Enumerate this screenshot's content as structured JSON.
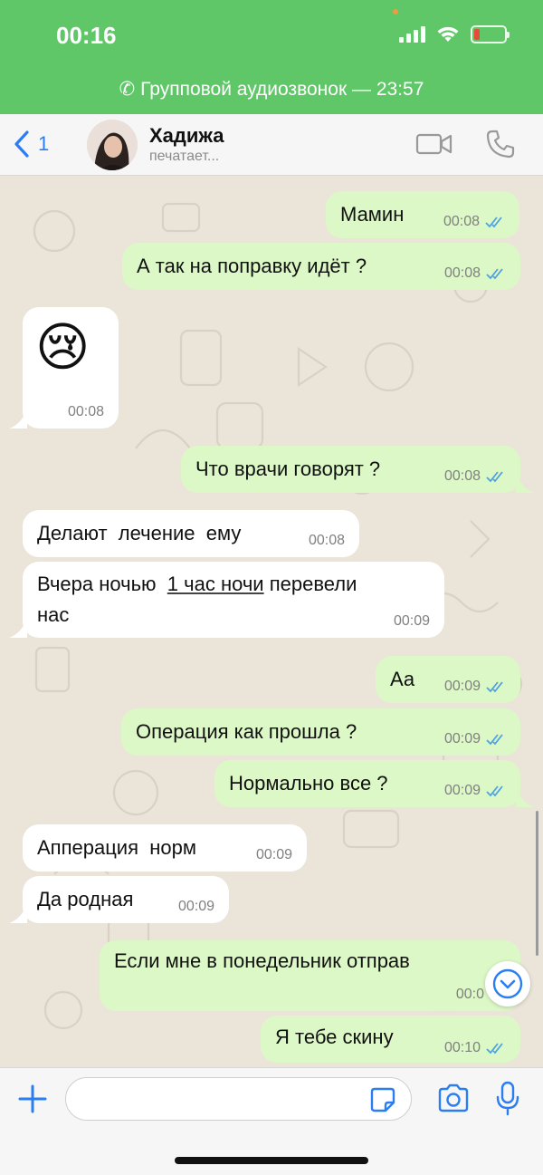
{
  "status_bar": {
    "time": "00:16",
    "call_banner": "Групповой аудиозвонок — 23:57"
  },
  "header": {
    "back_count": "1",
    "contact_name": "Хадижа",
    "contact_status": "печатает..."
  },
  "messages": [
    {
      "direction": "out",
      "text": "Мамин",
      "time": "00:08",
      "read": true
    },
    {
      "direction": "out",
      "text": "А так на поправку идёт ?",
      "time": "00:08",
      "read": true
    },
    {
      "direction": "in",
      "emoji": "😢",
      "time": "00:08"
    },
    {
      "direction": "out",
      "text": "Что врачи говорят ?",
      "time": "00:08",
      "read": true
    },
    {
      "direction": "in",
      "text": "Делают  лечение  ему",
      "time": "00:08"
    },
    {
      "direction": "in",
      "text_before": "Вчера ночью  ",
      "text_link": "1 час ночи",
      "text_after": " перевели",
      "text_line2": "нас",
      "time": "00:09"
    },
    {
      "direction": "out",
      "text": "Аа",
      "time": "00:09",
      "read": true
    },
    {
      "direction": "out",
      "text": "Операция как прошла ?",
      "time": "00:09",
      "read": true
    },
    {
      "direction": "out",
      "text": "Нормально все ?",
      "time": "00:09",
      "read": true
    },
    {
      "direction": "in",
      "text": "Апперация  норм",
      "time": "00:09"
    },
    {
      "direction": "in",
      "text": "Да родная",
      "time": "00:09"
    },
    {
      "direction": "out",
      "text": "Если мне в понедельник отправ",
      "time": "00:0",
      "read": true
    },
    {
      "direction": "out",
      "text": "Я тебе скину",
      "time": "00:10",
      "read": true
    }
  ],
  "input": {
    "placeholder": ""
  },
  "colors": {
    "status_bar": "#5fc768",
    "accent": "#2b7ef2",
    "outgoing_bubble": "#dcf8c6",
    "incoming_bubble": "#ffffff",
    "read_ticks": "#4fa3e0"
  },
  "icons": [
    "back-chevron-icon",
    "video-call-icon",
    "phone-icon",
    "attach-plus-icon",
    "sticker-icon",
    "camera-icon",
    "microphone-icon",
    "scroll-down-icon"
  ]
}
